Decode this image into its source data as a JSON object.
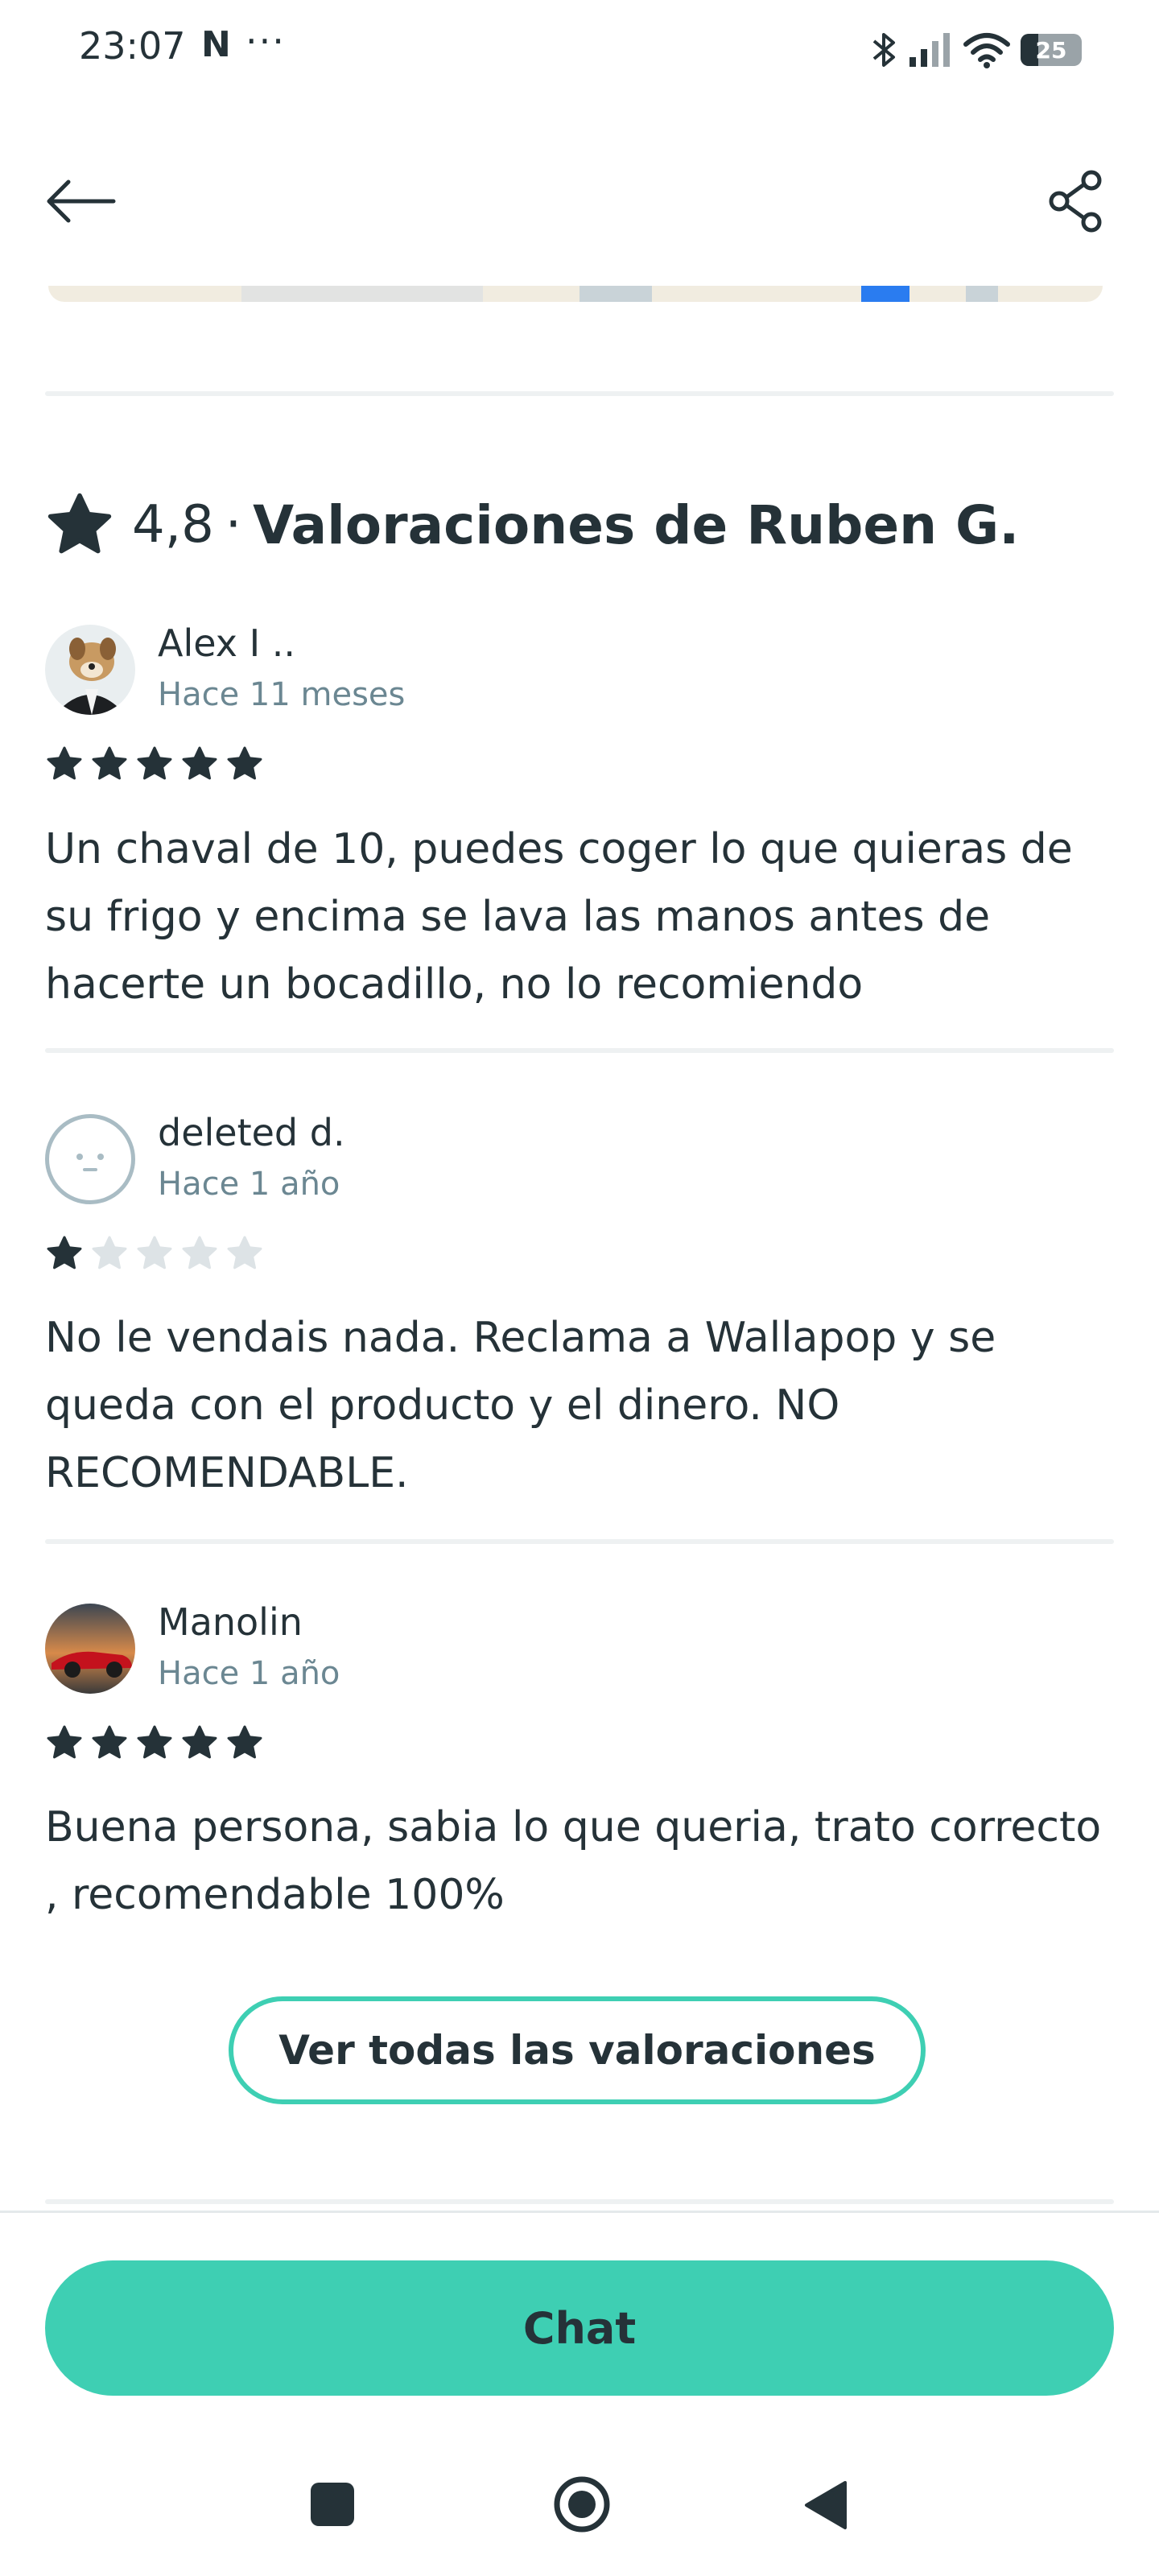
{
  "status_bar": {
    "time": "23:07",
    "notification_glyph": "N",
    "more_dots": "···",
    "battery": "25"
  },
  "header": {
    "back_icon": "arrow-left-icon",
    "share_icon": "share-icon"
  },
  "rating": {
    "score": "4,8",
    "separator": "·",
    "title": "Valoraciones de Ruben G."
  },
  "reviews": [
    {
      "name": "Alex I ..",
      "time": "Hace 11 meses",
      "stars": 5,
      "text": "Un chaval de 10, puedes coger lo que quieras de su frigo y encima se lava las manos antes de hacerte un bocadillo, no lo recomiendo"
    },
    {
      "name": "deleted d.",
      "time": "Hace 1 año",
      "stars": 1,
      "text": "No le vendais nada. Reclama a Wallapop y se queda con el producto y el dinero. NO RECOMENDABLE."
    },
    {
      "name": "Manolin",
      "time": "Hace 1 año",
      "stars": 5,
      "text": "Buena persona, sabia lo que queria, trato correcto , recomendable 100%"
    }
  ],
  "buttons": {
    "see_all": "Ver todas las valoraciones",
    "chat": "Chat"
  },
  "colors": {
    "accent": "#3ecfb3",
    "text": "#253238",
    "muted": "#6b8792",
    "star_empty": "#dde3e6"
  }
}
